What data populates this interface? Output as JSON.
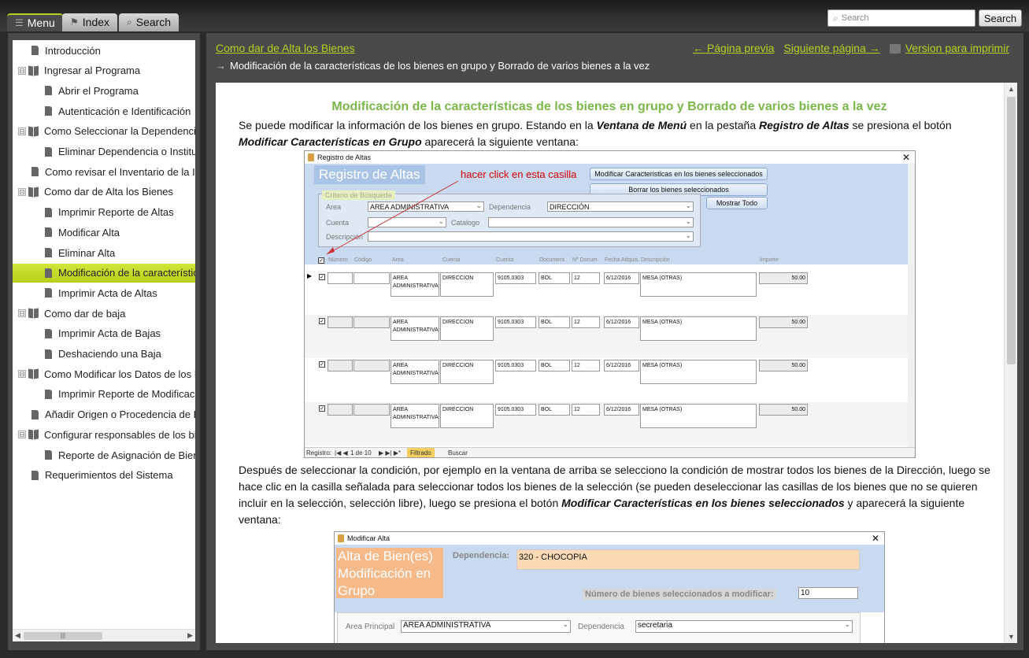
{
  "tabs": [
    {
      "label": "Menu",
      "icon": "list-icon",
      "active": true
    },
    {
      "label": "Index",
      "icon": "signpost-icon",
      "active": false
    },
    {
      "label": "Search",
      "icon": "magnifier-icon",
      "active": false
    }
  ],
  "search": {
    "placeholder": "Search",
    "button_label": "Search"
  },
  "tree": [
    {
      "label": "Introducción",
      "level": 0,
      "type": "page"
    },
    {
      "label": "Ingresar al Programa",
      "level": 0,
      "type": "book",
      "expander": "⊟"
    },
    {
      "label": "Abrir el Programa",
      "level": 1,
      "type": "page"
    },
    {
      "label": "Autenticación e Identificación",
      "level": 1,
      "type": "page"
    },
    {
      "label": "Como Seleccionar la Dependencia",
      "level": 0,
      "type": "book",
      "expander": "⊟"
    },
    {
      "label": "Eliminar Dependencia o Institución",
      "level": 1,
      "type": "page"
    },
    {
      "label": "Como revisar el Inventario de la Institución",
      "level": 0,
      "type": "page"
    },
    {
      "label": "Como dar de Alta los Bienes",
      "level": 0,
      "type": "book",
      "expander": "⊟"
    },
    {
      "label": "Imprimir Reporte de Altas",
      "level": 1,
      "type": "page"
    },
    {
      "label": "Modificar Alta",
      "level": 1,
      "type": "page"
    },
    {
      "label": "Eliminar Alta",
      "level": 1,
      "type": "page"
    },
    {
      "label": "Modificación de la características de los bienes",
      "level": 1,
      "type": "page",
      "selected": true
    },
    {
      "label": "Imprimir Acta de Altas",
      "level": 1,
      "type": "page"
    },
    {
      "label": "Como dar de baja",
      "level": 0,
      "type": "book",
      "expander": "⊟"
    },
    {
      "label": "Imprimir Acta de Bajas",
      "level": 1,
      "type": "page"
    },
    {
      "label": "Deshaciendo una Baja",
      "level": 1,
      "type": "page"
    },
    {
      "label": "Como Modificar los Datos de los Bienes",
      "level": 0,
      "type": "book",
      "expander": "⊟"
    },
    {
      "label": "Imprimir Reporte de Modificaciones",
      "level": 1,
      "type": "page"
    },
    {
      "label": "Añadir Origen o Procedencia de Bienes",
      "level": 0,
      "type": "page"
    },
    {
      "label": "Configurar responsables de los bienes",
      "level": 0,
      "type": "book",
      "expander": "⊟"
    },
    {
      "label": "Reporte de Asignación de Bienes",
      "level": 1,
      "type": "page"
    },
    {
      "label": "Requerimientos del Sistema",
      "level": 0,
      "type": "page"
    }
  ],
  "header": {
    "breadcrumb": "Como dar de Alta los Bienes",
    "arrow": "→",
    "subtitle": "Modificación de la características de los bienes en grupo y Borrado de varios bienes a la vez",
    "prev": "← Página previa",
    "next": "Siguiente página →",
    "print": "Version para imprimir"
  },
  "article": {
    "title": "Modificación de la características de los bienes en grupo y Borrado de varios bienes a la vez",
    "p1": [
      {
        "t": "Se puede modificar la información de los bienes en grupo. Estando en la ",
        "b": false
      },
      {
        "t": "Ventana de Menú",
        "b": true
      },
      {
        "t": " en la pestaña ",
        "b": false
      },
      {
        "t": "Registro de Altas",
        "b": true
      },
      {
        "t": " se presiona el botón ",
        "b": false
      },
      {
        "t": "Modificar Características en Grupo",
        "b": true
      },
      {
        "t": " aparecerá la siguiente ventana:",
        "b": false
      }
    ],
    "p2": [
      {
        "t": "Después de seleccionar la condición, por ejemplo en la ventana de arriba se selecciono la condición de mostrar todos los bienes de la Dirección, luego se hace clic en la casilla señalada para seleccionar todos los bienes de la selección (se pueden deseleccionar las casillas de los bienes que no se quieren incluir en la selección, selección libre), luego se presiona el botón ",
        "b": false
      },
      {
        "t": "Modificar Características en los bienes seleccionados",
        "b": true
      },
      {
        "t": " y aparecerá la siguiente ventana:",
        "b": false
      }
    ]
  },
  "shot1": {
    "window_title": "Registro de Altas",
    "heading": "Registro de Altas",
    "note": "hacer click en esta casilla",
    "btn_modify": "Modificar Caracteristicas en los bienes seleccionados",
    "btn_delete": "Borrar los bienes seleccionados",
    "btn_show_all": "Mostrar Todo",
    "criteria_legend": "Criterio de Búsqueda",
    "lbl_area": "Area",
    "val_area": "AREA ADMINISTRATIVA",
    "lbl_dependencia": "Dependencia",
    "val_dependencia": "DIRECCIÓN",
    "lbl_cuenta": "Cuenta",
    "lbl_catalogo": "Catalogo",
    "lbl_descripcion": "Descripción",
    "columns": [
      "Número",
      "Código",
      "Area",
      "Cuenta",
      "Cuenta",
      "Document.",
      "Nº Docum",
      "Fecha Adquis.",
      "Descripción",
      "Importe"
    ],
    "rows": [
      {
        "area": "AREA ADMINISTRATIVA",
        "dep": "DIRECCION",
        "cuenta": "9105.0303",
        "doc": "BOL",
        "ndoc": "12",
        "fecha": "6/12/2016",
        "desc": "MESA (OTRAS)",
        "importe": "50.00"
      },
      {
        "area": "AREA ADMINISTRATIVA",
        "dep": "DIRECCION",
        "cuenta": "9105.0303",
        "doc": "BOL",
        "ndoc": "12",
        "fecha": "6/12/2016",
        "desc": "MESA (OTRAS)",
        "importe": "50.00"
      },
      {
        "area": "AREA ADMINISTRATIVA",
        "dep": "DIRECCION",
        "cuenta": "9105.0303",
        "doc": "BOL",
        "ndoc": "12",
        "fecha": "6/12/2016",
        "desc": "MESA (OTRAS)",
        "importe": "50.00"
      },
      {
        "area": "AREA ADMINISTRATIVA",
        "dep": "DIRECCION",
        "cuenta": "9105.0303",
        "doc": "BOL",
        "ndoc": "12",
        "fecha": "6/12/2016",
        "desc": "MESA (OTRAS)",
        "importe": "50.00"
      }
    ],
    "status_registro": "Registro:",
    "status_pos": "1 de 10",
    "status_filter": "Filtrado",
    "status_search": "Buscar"
  },
  "shot2": {
    "window_title": "Modificar Alta",
    "heading": "Alta de Bien(es) Modificación en Grupo",
    "lbl_dependencia": "Dependencia:",
    "val_dependencia": "320 - CHOCOPIA",
    "lbl_num": "Número de bienes seleccionados a modificar:",
    "val_num": "10",
    "lbl_area_principal": "Area Principal",
    "val_area_principal": "AREA ADMINISTRATIVA",
    "lbl_dep2": "Dependencia",
    "val_dep2": "secretaria"
  },
  "colors": {
    "accent": "#b6d020",
    "title_green": "#7ab648",
    "dark_bg": "#2b2b2b",
    "panel": "#4a4a4a"
  }
}
